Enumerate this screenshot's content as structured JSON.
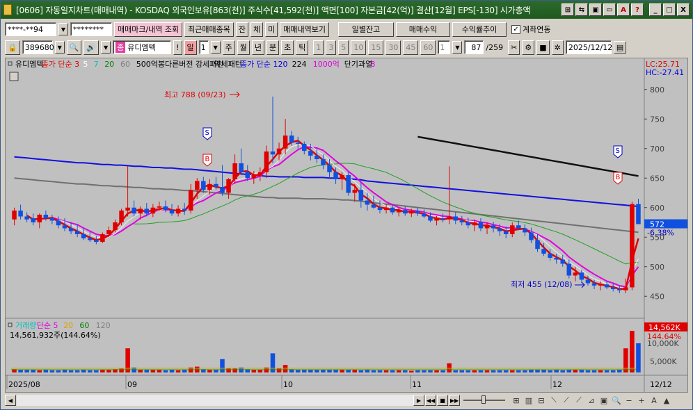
{
  "titlebar": {
    "text": "[0606] 자동일지차트(매매내역) - KOSDAQ 외국인보유[863(천)] 주식수[41,592(천)] 액면[100] 자본금[42(억)] 결산[12월] EPS[-130] 시가총액",
    "buttons": [
      "⊞",
      "⇆",
      "▣",
      "▭",
      "A",
      "?",
      "_",
      "□",
      "X"
    ]
  },
  "toolbar1": {
    "account": "****-**94",
    "password": "********",
    "btn_trade_mark": "매매마크/내역 조회",
    "btn_recent": "최근매매종목",
    "btn_jan": "잔",
    "btn_che": "체",
    "btn_mi": "미",
    "btn_trade_view": "매매내역보기",
    "btn_daily_balance": "일별잔고",
    "btn_trade_profit": "매매수익",
    "btn_return_trend": "수익률추이",
    "account_link_label": "계좌연동",
    "account_link_checked": "✓"
  },
  "toolbar2": {
    "code": "389680",
    "stock_badge": "종",
    "stock_name": "유디엠텍",
    "bang": "!",
    "period_il": "일",
    "period_num": "1",
    "period_ju": "주",
    "period_wol": "월",
    "period_nyeon": "년",
    "period_bun": "분",
    "period_cho": "초",
    "period_tik": "틱",
    "minutes": [
      "1",
      "3",
      "5",
      "10",
      "15",
      "30",
      "45",
      "60"
    ],
    "min_sel": "1",
    "count": "87",
    "total": "/259",
    "date": "2025/12/12"
  },
  "chart_data": {
    "type": "candlestick",
    "legend_price": [
      {
        "text": "유디엠텍",
        "color": "#000000"
      },
      {
        "text": "종가 단순 3",
        "color": "#e00000"
      },
      {
        "text": "5",
        "color": "#ffffff"
      },
      {
        "text": "7",
        "color": "#00c0c0"
      },
      {
        "text": "20",
        "color": "#008000"
      },
      {
        "text": "60",
        "color": "#808080"
      },
      {
        "text": "500억봉다른버전 강세패턴",
        "color": "#000000"
      },
      {
        "text": "약세패턴",
        "color": "#000000"
      },
      {
        "text": "종가 단순 120",
        "color": "#0000e0"
      },
      {
        "text": "224",
        "color": "#000000"
      },
      {
        "text": "1000억",
        "color": "#e000e0"
      },
      {
        "text": "단기과열",
        "color": "#000000"
      },
      {
        "text": "8",
        "color": "#e000e0"
      }
    ],
    "lc_label": "LC:25.71",
    "hc_label": "HC:-27.41",
    "y_ticks": [
      "800",
      "750",
      "700",
      "650",
      "600",
      "550",
      "500",
      "450"
    ],
    "current_price": "572",
    "current_change": "-6.38%",
    "high_label": "최고 788 (09/23)",
    "low_label": "최저 455 (12/08)",
    "signal_buy": "B",
    "signal_sell": "S",
    "legend_volume": [
      {
        "text": "거래량",
        "color": "#00c0c0"
      },
      {
        "text": "단순 5",
        "color": "#e000e0"
      },
      {
        "text": "20",
        "color": "#e0a000"
      },
      {
        "text": "60",
        "color": "#008000"
      },
      {
        "text": "120",
        "color": "#808080"
      }
    ],
    "volume_text": "14,561,932주(144.64%)",
    "vol_last": "14,562K",
    "vol_pct": "144.64%",
    "vol_ticks": [
      "10,000K",
      "5,000K"
    ],
    "x_labels": [
      "2025/08",
      "09",
      "10",
      "11",
      "12"
    ],
    "x_right": "12/12",
    "ylim": [
      415,
      815
    ],
    "candles": [
      [
        580,
        600,
        570,
        595
      ],
      [
        595,
        605,
        580,
        585
      ],
      [
        585,
        592,
        575,
        580
      ],
      [
        582,
        590,
        570,
        575
      ],
      [
        575,
        590,
        565,
        588
      ],
      [
        588,
        595,
        578,
        582
      ],
      [
        582,
        588,
        572,
        578
      ],
      [
        578,
        585,
        565,
        570
      ],
      [
        570,
        582,
        560,
        565
      ],
      [
        565,
        575,
        555,
        560
      ],
      [
        560,
        572,
        550,
        555
      ],
      [
        555,
        565,
        545,
        548
      ],
      [
        548,
        560,
        542,
        545
      ],
      [
        545,
        552,
        538,
        542
      ],
      [
        542,
        558,
        540,
        555
      ],
      [
        555,
        568,
        550,
        562
      ],
      [
        562,
        580,
        558,
        575
      ],
      [
        575,
        598,
        570,
        595
      ],
      [
        595,
        670,
        585,
        600
      ],
      [
        600,
        612,
        585,
        590
      ],
      [
        590,
        602,
        580,
        598
      ],
      [
        598,
        608,
        585,
        590
      ],
      [
        590,
        606,
        584,
        600
      ],
      [
        600,
        610,
        595,
        602
      ],
      [
        602,
        612,
        592,
        596
      ],
      [
        596,
        606,
        586,
        590
      ],
      [
        590,
        604,
        585,
        598
      ],
      [
        598,
        608,
        588,
        595
      ],
      [
        595,
        640,
        590,
        630
      ],
      [
        630,
        650,
        615,
        645
      ],
      [
        645,
        652,
        625,
        630
      ],
      [
        630,
        648,
        622,
        640
      ],
      [
        640,
        652,
        630,
        635
      ],
      [
        635,
        672,
        620,
        625
      ],
      [
        625,
        650,
        615,
        648
      ],
      [
        648,
        690,
        640,
        675
      ],
      [
        675,
        700,
        655,
        660
      ],
      [
        660,
        672,
        645,
        650
      ],
      [
        650,
        662,
        640,
        655
      ],
      [
        655,
        668,
        645,
        660
      ],
      [
        660,
        705,
        650,
        695
      ],
      [
        695,
        788,
        675,
        690
      ],
      [
        690,
        710,
        680,
        700
      ],
      [
        700,
        750,
        690,
        722
      ],
      [
        722,
        730,
        705,
        710
      ],
      [
        710,
        720,
        700,
        708
      ],
      [
        708,
        712,
        690,
        696
      ],
      [
        696,
        708,
        680,
        688
      ],
      [
        688,
        700,
        675,
        682
      ],
      [
        682,
        690,
        665,
        672
      ],
      [
        672,
        682,
        650,
        660
      ],
      [
        660,
        668,
        640,
        648
      ],
      [
        648,
        660,
        630,
        655
      ],
      [
        655,
        660,
        620,
        625
      ],
      [
        625,
        640,
        610,
        630
      ],
      [
        630,
        642,
        600,
        612
      ],
      [
        612,
        625,
        595,
        605
      ],
      [
        605,
        620,
        598,
        600
      ],
      [
        600,
        612,
        590,
        596
      ],
      [
        596,
        606,
        590,
        600
      ],
      [
        600,
        606,
        588,
        592
      ],
      [
        592,
        600,
        585,
        596
      ],
      [
        596,
        602,
        586,
        590
      ],
      [
        590,
        598,
        584,
        594
      ],
      [
        594,
        600,
        586,
        590
      ],
      [
        590,
        597,
        582,
        585
      ],
      [
        585,
        592,
        575,
        578
      ],
      [
        578,
        586,
        570,
        582
      ],
      [
        582,
        590,
        575,
        580
      ],
      [
        580,
        670,
        572,
        585
      ],
      [
        585,
        592,
        572,
        578
      ],
      [
        578,
        586,
        570,
        575
      ],
      [
        575,
        583,
        565,
        570
      ],
      [
        570,
        580,
        560,
        575
      ],
      [
        575,
        582,
        560,
        565
      ],
      [
        565,
        575,
        555,
        570
      ],
      [
        570,
        576,
        558,
        565
      ],
      [
        565,
        572,
        552,
        560
      ],
      [
        560,
        568,
        548,
        555
      ],
      [
        555,
        575,
        550,
        570
      ],
      [
        570,
        578,
        562,
        565
      ],
      [
        565,
        572,
        552,
        558
      ],
      [
        558,
        566,
        540,
        545
      ],
      [
        545,
        555,
        525,
        530
      ],
      [
        530,
        540,
        518,
        522
      ],
      [
        522,
        530,
        510,
        515
      ],
      [
        515,
        522,
        505,
        512
      ],
      [
        512,
        520,
        500,
        505
      ],
      [
        505,
        512,
        480,
        485
      ],
      [
        485,
        500,
        475,
        490
      ],
      [
        490,
        495,
        472,
        478
      ],
      [
        478,
        485,
        468,
        472
      ],
      [
        472,
        478,
        462,
        468
      ],
      [
        468,
        475,
        460,
        470
      ],
      [
        470,
        476,
        462,
        465
      ],
      [
        465,
        472,
        458,
        462
      ],
      [
        462,
        468,
        455,
        460
      ],
      [
        460,
        480,
        455,
        465
      ],
      [
        465,
        610,
        460,
        606
      ],
      [
        606,
        615,
        575,
        572
      ]
    ],
    "volume_ratio": [
      0.08,
      0.07,
      0.06,
      0.06,
      0.05,
      0.06,
      0.05,
      0.05,
      0.06,
      0.05,
      0.05,
      0.06,
      0.05,
      0.05,
      0.06,
      0.07,
      0.08,
      0.09,
      0.58,
      0.12,
      0.07,
      0.06,
      0.07,
      0.06,
      0.05,
      0.06,
      0.05,
      0.06,
      0.12,
      0.14,
      0.08,
      0.07,
      0.06,
      0.32,
      0.1,
      0.1,
      0.12,
      0.08,
      0.07,
      0.06,
      0.12,
      0.46,
      0.1,
      0.18,
      0.08,
      0.06,
      0.07,
      0.06,
      0.07,
      0.06,
      0.07,
      0.06,
      0.06,
      0.07,
      0.06,
      0.05,
      0.06,
      0.05,
      0.05,
      0.05,
      0.05,
      0.05,
      0.05,
      0.04,
      0.05,
      0.05,
      0.05,
      0.05,
      0.05,
      0.22,
      0.05,
      0.05,
      0.05,
      0.05,
      0.05,
      0.05,
      0.05,
      0.05,
      0.05,
      0.05,
      0.05,
      0.05,
      0.06,
      0.06,
      0.06,
      0.05,
      0.06,
      0.05,
      0.06,
      0.06,
      0.06,
      0.05,
      0.05,
      0.05,
      0.05,
      0.05,
      0.06,
      0.58,
      1.0,
      0.7
    ],
    "ma120": [
      686,
      685,
      684,
      683,
      682,
      681,
      680,
      679,
      678,
      677,
      676,
      676,
      675,
      674,
      673,
      673,
      672,
      672,
      671,
      670,
      670,
      669,
      668,
      668,
      667,
      667,
      666,
      665,
      665,
      664,
      663,
      662,
      661,
      660,
      659,
      658,
      657,
      656,
      655,
      654,
      653,
      653,
      652,
      652,
      652,
      652,
      651,
      651,
      651,
      651,
      650,
      650,
      649,
      649,
      648,
      647,
      645,
      644,
      643,
      642,
      641,
      640,
      639,
      638,
      637,
      636,
      635,
      634,
      633,
      632,
      631,
      630,
      629,
      628,
      627,
      626,
      625,
      624,
      623,
      622,
      621,
      620,
      619,
      618,
      617,
      616,
      615,
      614,
      613,
      612,
      611,
      610,
      609,
      608,
      607,
      606,
      605,
      604,
      603,
      602
    ],
    "ma224": [
      null,
      null,
      null,
      null,
      null,
      null,
      null,
      null,
      null,
      null,
      null,
      null,
      null,
      null,
      null,
      null,
      null,
      null,
      null,
      null,
      null,
      null,
      null,
      null,
      null,
      null,
      null,
      null,
      null,
      null,
      null,
      null,
      null,
      null,
      null,
      null,
      null,
      null,
      null,
      null,
      null,
      null,
      null,
      null,
      null,
      null,
      null,
      null,
      null,
      null,
      null,
      null,
      null,
      null,
      null,
      null,
      null,
      null,
      null,
      null,
      null,
      null,
      null,
      null,
      null,
      null,
      null,
      null,
      null,
      null,
      null,
      null,
      null,
      null,
      null,
      null,
      null,
      null,
      null,
      null,
      null,
      null,
      null,
      null,
      null,
      null,
      null,
      null,
      null,
      null,
      null,
      null,
      null,
      null,
      null,
      null,
      null,
      null,
      null,
      null
    ]
  }
}
